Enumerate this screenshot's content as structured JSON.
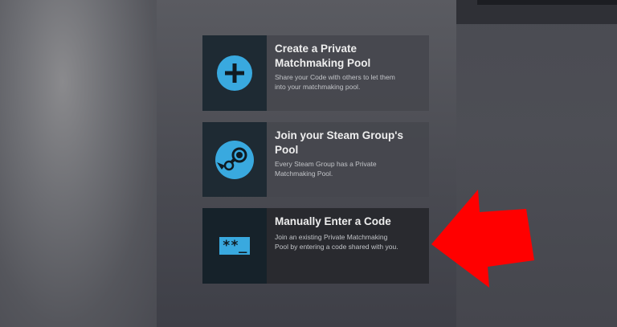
{
  "cards": [
    {
      "title": "Create a Private\nMatchmaking Pool",
      "desc": "Share your Code with others to let them\ninto your matchmaking pool.",
      "icon": "plus-icon"
    },
    {
      "title": "Join your Steam Group's\nPool",
      "desc": "Every Steam Group has a Private\nMatchmaking Pool.",
      "icon": "steam-icon"
    },
    {
      "title": "Manually Enter a Code",
      "desc": "Join an existing Private Matchmaking\nPool by entering a code shared with you.",
      "icon": "code-prompt-icon",
      "icon_text": "**_"
    }
  ],
  "colors": {
    "accent": "#39a9df",
    "arrow": "#ff0000"
  }
}
